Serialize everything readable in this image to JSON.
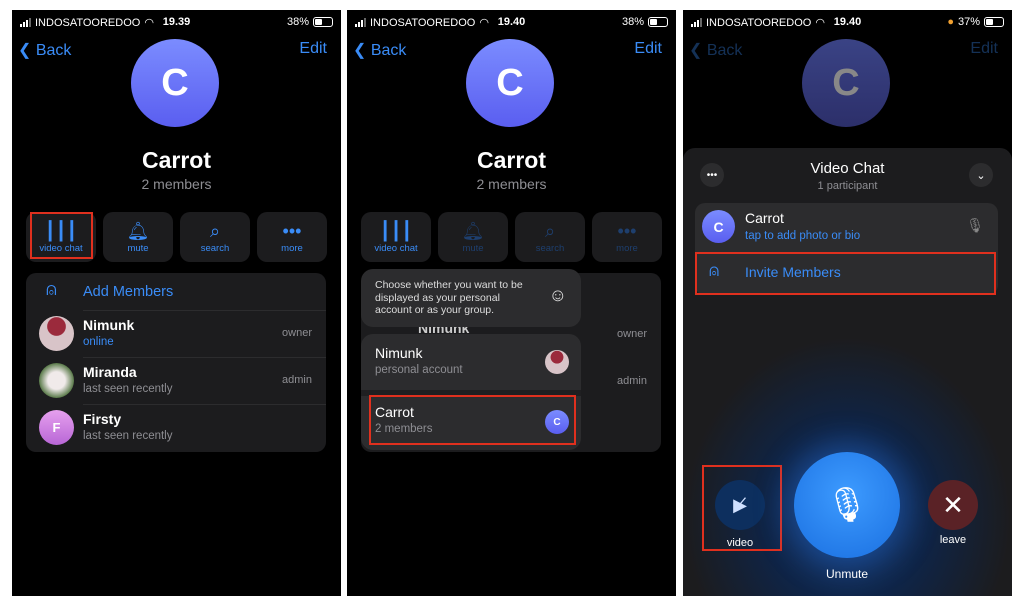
{
  "screens": [
    {
      "status": {
        "carrier": "INDOSATOOREDOO",
        "time": "19.39",
        "battery": "38%",
        "battery_level": 38
      },
      "nav": {
        "back": "Back",
        "edit": "Edit"
      },
      "group": {
        "initial": "C",
        "name": "Carrot",
        "members": "2 members"
      },
      "actions": [
        {
          "label": "video chat",
          "icon": "waveform-icon"
        },
        {
          "label": "mute",
          "icon": "bell-icon"
        },
        {
          "label": "search",
          "icon": "search-icon"
        },
        {
          "label": "more",
          "icon": "more-icon"
        }
      ],
      "add_members": "Add Members",
      "members": [
        {
          "name": "Nimunk",
          "status": "online",
          "role": "owner"
        },
        {
          "name": "Miranda",
          "status": "last seen recently",
          "role": "admin"
        },
        {
          "name": "Firsty",
          "status": "last seen recently",
          "role": "",
          "initial": "F"
        }
      ]
    },
    {
      "status": {
        "carrier": "INDOSATOOREDOO",
        "time": "19.40",
        "battery": "38%",
        "battery_level": 38
      },
      "nav": {
        "back": "Back",
        "edit": "Edit"
      },
      "group": {
        "initial": "C",
        "name": "Carrot",
        "members": "2 members"
      },
      "actions": [
        {
          "label": "video chat"
        },
        {
          "label": "mute"
        },
        {
          "label": "search"
        },
        {
          "label": "more"
        }
      ],
      "members_bg": [
        {
          "name": "Nimunk",
          "role": "owner"
        },
        {
          "role": "admin"
        }
      ],
      "popover": {
        "hint": "Choose whether you want to be displayed as your personal account or as your group.",
        "options": [
          {
            "name": "Nimunk",
            "sub": "personal account"
          },
          {
            "name": "Carrot",
            "sub": "2 members",
            "initial": "C"
          }
        ]
      }
    },
    {
      "status": {
        "carrier": "INDOSATOOREDOO",
        "time": "19.40",
        "battery": "37%",
        "battery_level": 37
      },
      "nav": {
        "back": "Back",
        "edit": "Edit"
      },
      "group": {
        "initial": "C"
      },
      "video_chat": {
        "title": "Video Chat",
        "participants": "1 participant",
        "participant": {
          "initial": "C",
          "name": "Carrot",
          "sub": "tap to add photo or bio"
        },
        "invite": "Invite Members",
        "video_label": "video",
        "unmute_label": "Unmute",
        "leave_label": "leave"
      }
    }
  ],
  "colors": {
    "accent": "#3a8cf7",
    "highlight": "#e0301e",
    "leave": "#5a2226"
  }
}
